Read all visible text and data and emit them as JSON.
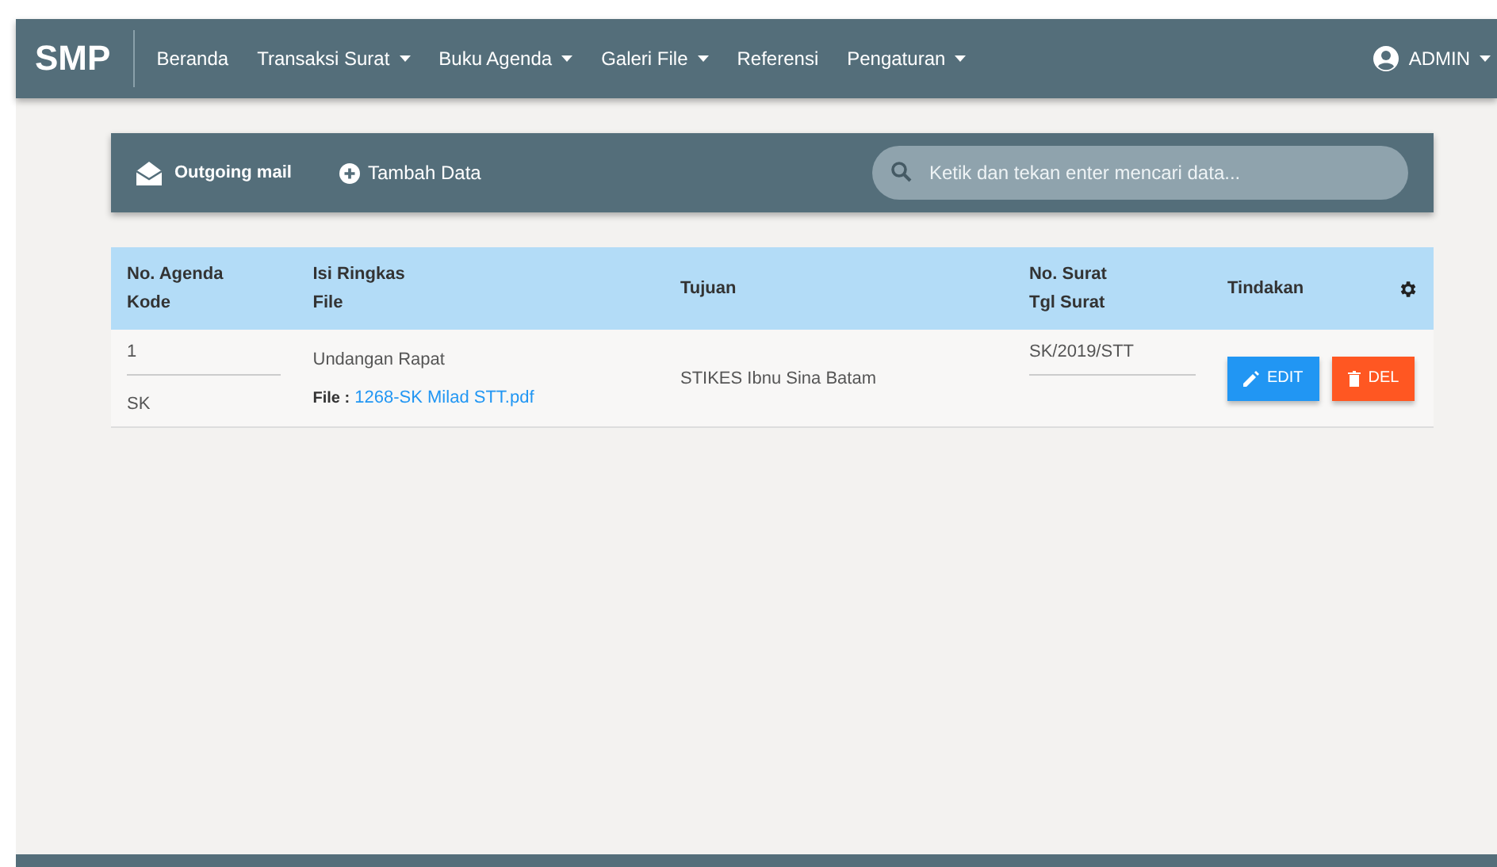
{
  "navbar": {
    "brand": "SMP",
    "items": [
      {
        "label": "Beranda",
        "dropdown": false
      },
      {
        "label": "Transaksi Surat",
        "dropdown": true
      },
      {
        "label": "Buku Agenda",
        "dropdown": true
      },
      {
        "label": "Galeri File",
        "dropdown": true
      },
      {
        "label": "Referensi",
        "dropdown": false
      },
      {
        "label": "Pengaturan",
        "dropdown": true
      }
    ],
    "user": {
      "label": "ADMIN",
      "dropdown": true
    }
  },
  "toolbar": {
    "title": "Outgoing mail",
    "add_button": "Tambah Data",
    "search": {
      "placeholder": "Ketik dan tekan enter mencari data..."
    }
  },
  "table": {
    "columns": [
      [
        "No. Agenda",
        "Kode"
      ],
      [
        "Isi Ringkas",
        "File"
      ],
      [
        "Tujuan"
      ],
      [
        "No. Surat",
        "Tgl Surat"
      ],
      [
        "Tindakan"
      ]
    ],
    "rows": [
      {
        "no_agenda": "1",
        "kode": "SK",
        "isi_ringkas": "Undangan Rapat",
        "file_label": "File :",
        "file": "1268-SK Milad STT.pdf",
        "tujuan": "STIKES Ibnu Sina Batam",
        "no_surat": "SK/2019/STT",
        "actions": [
          "EDIT",
          "DEL"
        ]
      }
    ]
  }
}
